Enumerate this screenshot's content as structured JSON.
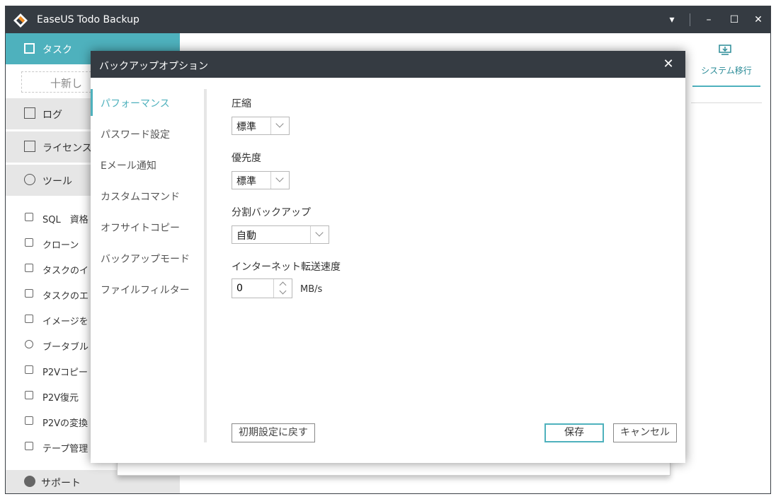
{
  "window": {
    "title": "EaseUS Todo Backup"
  },
  "titlebar": {
    "menu_glyph": "▾",
    "minimize_glyph": "–",
    "maximize_glyph": "☐",
    "close_glyph": "✕"
  },
  "sidebar": {
    "task_label": "タスク",
    "new_label": "十新し",
    "log_label": "ログ",
    "license_label": "ライセンス",
    "tools_label": "ツール",
    "tool_items": [
      {
        "label": "SQL　資格",
        "icon": "database-icon"
      },
      {
        "label": "クローン",
        "icon": "clone-icon"
      },
      {
        "label": "タスクのイ",
        "icon": "import-icon"
      },
      {
        "label": "タスクのエ",
        "icon": "export-icon"
      },
      {
        "label": "イメージを",
        "icon": "image-check-icon"
      },
      {
        "label": "ブータブル",
        "icon": "bootable-icon"
      },
      {
        "label": "P2Vコピー",
        "icon": "p2v-copy-icon"
      },
      {
        "label": "P2V復元",
        "icon": "p2v-restore-icon"
      },
      {
        "label": "P2Vの変換",
        "icon": "p2v-convert-icon"
      },
      {
        "label": "テープ管理",
        "icon": "tape-icon"
      }
    ],
    "support_label": "サポート"
  },
  "main": {
    "system_migration_label": "システム移行"
  },
  "dialog": {
    "title": "バックアップオプション",
    "close_glyph": "✕",
    "nav": [
      {
        "label": "パフォーマンス",
        "active": true
      },
      {
        "label": "パスワード設定",
        "active": false
      },
      {
        "label": "Eメール通知",
        "active": false
      },
      {
        "label": "カスタムコマンド",
        "active": false
      },
      {
        "label": "オフサイトコピー",
        "active": false
      },
      {
        "label": "バックアップモード",
        "active": false
      },
      {
        "label": "ファイルフィルター",
        "active": false
      }
    ],
    "compression": {
      "label": "圧縮",
      "value": "標準"
    },
    "priority": {
      "label": "優先度",
      "value": "標準"
    },
    "split": {
      "label": "分割バックアップ",
      "value": "自動"
    },
    "speed": {
      "label": "インターネット転送速度",
      "value": "0",
      "unit": "MB/s"
    },
    "reset_label": "初期設定に戻す",
    "save_label": "保存",
    "cancel_label": "キャンセル"
  },
  "colors": {
    "accent": "#4eb1bd",
    "titlebar": "#353b42"
  }
}
